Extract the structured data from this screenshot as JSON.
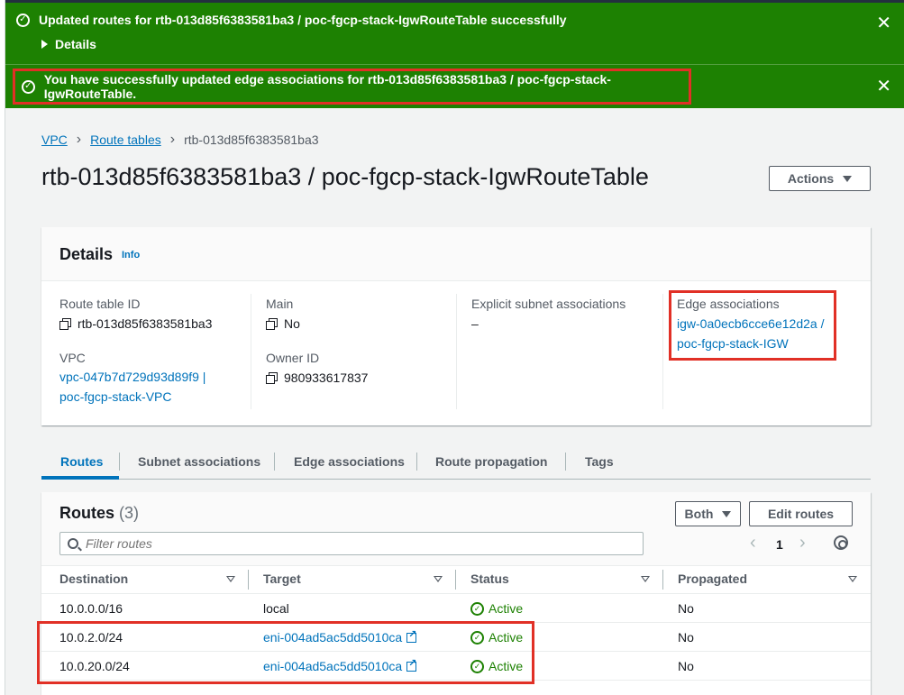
{
  "flash": {
    "success_message_1": "Updated routes for rtb-013d85f6383581ba3 / poc-fgcp-stack-IgwRouteTable successfully",
    "details_label": "Details",
    "success_message_2": "You have successfully updated edge associations for rtb-013d85f6383581ba3 / poc-fgcp-stack-IgwRouteTable.",
    "close_glyph": "✕",
    "check_glyph": "✓"
  },
  "breadcrumb": {
    "items": [
      "VPC",
      "Route tables",
      "rtb-013d85f6383581ba3"
    ],
    "separator": "›"
  },
  "page_title": "rtb-013d85f6383581ba3 / poc-fgcp-stack-IgwRouteTable",
  "actions_label": "Actions",
  "details": {
    "heading": "Details",
    "info_label": "Info",
    "route_table_id_label": "Route table ID",
    "route_table_id": "rtb-013d85f6383581ba3",
    "vpc_label": "VPC",
    "vpc_line1": "vpc-047b7d729d93d89f9 |",
    "vpc_line2": "poc-fgcp-stack-VPC",
    "main_label": "Main",
    "main_value": "No",
    "owner_id_label": "Owner ID",
    "owner_id": "980933617837",
    "explicit_subnet_label": "Explicit subnet associations",
    "explicit_subnet_value": "–",
    "edge_assoc_label": "Edge associations",
    "edge_assoc_line1": "igw-0a0ecb6cce6e12d2a /",
    "edge_assoc_line2": "poc-fgcp-stack-IGW"
  },
  "tabs": [
    {
      "label": "Routes",
      "active": true
    },
    {
      "label": "Subnet associations",
      "active": false
    },
    {
      "label": "Edge associations",
      "active": false
    },
    {
      "label": "Route propagation",
      "active": false
    },
    {
      "label": "Tags",
      "active": false
    }
  ],
  "routes": {
    "heading": "Routes",
    "count": "(3)",
    "filter_dropdown": "Both",
    "edit_button": "Edit routes",
    "filter_placeholder": "Filter routes",
    "page": "1",
    "prev_glyph": "‹",
    "next_glyph": "›",
    "columns": [
      "Destination",
      "Target",
      "Status",
      "Propagated"
    ],
    "rows": [
      {
        "destination": "10.0.0.0/16",
        "target": "local",
        "target_is_link": false,
        "status": "Active",
        "propagated": "No"
      },
      {
        "destination": "10.0.2.0/24",
        "target": "eni-004ad5ac5dd5010ca",
        "target_is_link": true,
        "status": "Active",
        "propagated": "No"
      },
      {
        "destination": "10.0.20.0/24",
        "target": "eni-004ad5ac5dd5010ca",
        "target_is_link": true,
        "status": "Active",
        "propagated": "No"
      }
    ]
  },
  "colors": {
    "flash_green": "#1d8102",
    "link_blue": "#0073bb",
    "highlight_red": "#e13026"
  }
}
